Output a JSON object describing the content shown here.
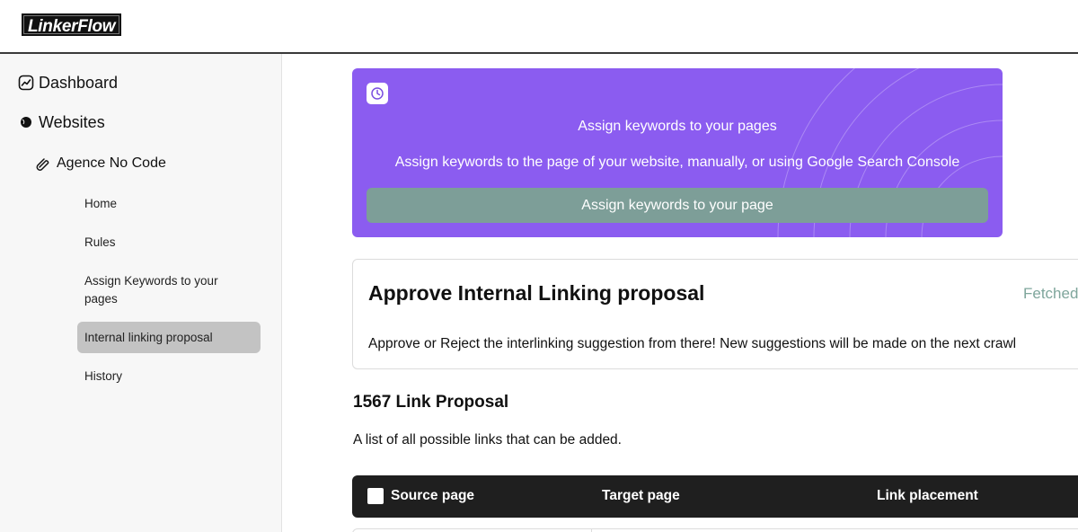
{
  "app": {
    "logo_text": "LinkerFlow"
  },
  "sidebar": {
    "dashboard_label": "Dashboard",
    "websites_label": "Websites",
    "site_label": "Agence No Code",
    "items": [
      {
        "label": "Home"
      },
      {
        "label": "Rules"
      },
      {
        "label": "Assign Keywords to your pages"
      },
      {
        "label": "Internal linking proposal",
        "active": true
      },
      {
        "label": "History"
      }
    ]
  },
  "hero": {
    "icon": "clock-icon",
    "title": "Assign keywords to your pages",
    "subtitle": "Assign keywords to the page of your website, manually, or using Google Search Console",
    "button_label": "Assign keywords to your page",
    "bg_color": "#8b5cf0",
    "button_color": "#7d9e98"
  },
  "approve": {
    "title": "Approve Internal Linking proposal",
    "status": "Fetched",
    "description": "Approve or Reject the interlinking suggestion from there! New suggestions will be made on the next crawl"
  },
  "proposals": {
    "count_title": "1567 Link Proposal",
    "description": "A list of all possible links that can be added."
  },
  "table": {
    "columns": [
      "Source page",
      "Target page",
      "Link placement"
    ]
  },
  "colors": {
    "accent": "#8b5cf0",
    "status_green": "#7fa69c",
    "header_dark": "#1f1f1f"
  }
}
